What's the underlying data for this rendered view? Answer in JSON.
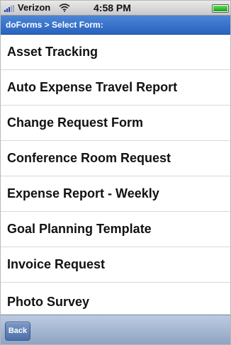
{
  "status_bar": {
    "carrier": "Verizon",
    "time": "4:58 PM",
    "signal_icon": "signal-bars-icon",
    "wifi_icon": "wifi-icon",
    "battery_icon": "battery-icon",
    "battery_level": 1.0
  },
  "nav_bar": {
    "title": "doForms > Select Form:"
  },
  "form_list": {
    "items": [
      {
        "label": "Asset Tracking"
      },
      {
        "label": "Auto Expense Travel Report"
      },
      {
        "label": "Change Request Form"
      },
      {
        "label": "Conference Room Request"
      },
      {
        "label": "Expense Report - Weekly"
      },
      {
        "label": "Goal Planning Template"
      },
      {
        "label": "Invoice Request"
      },
      {
        "label": "Photo Survey"
      }
    ]
  },
  "toolbar": {
    "back_label": "Back"
  },
  "colors": {
    "nav_bar": "#2a62bf",
    "toolbar": "#8ea3c3",
    "battery": "#1c9c18"
  }
}
